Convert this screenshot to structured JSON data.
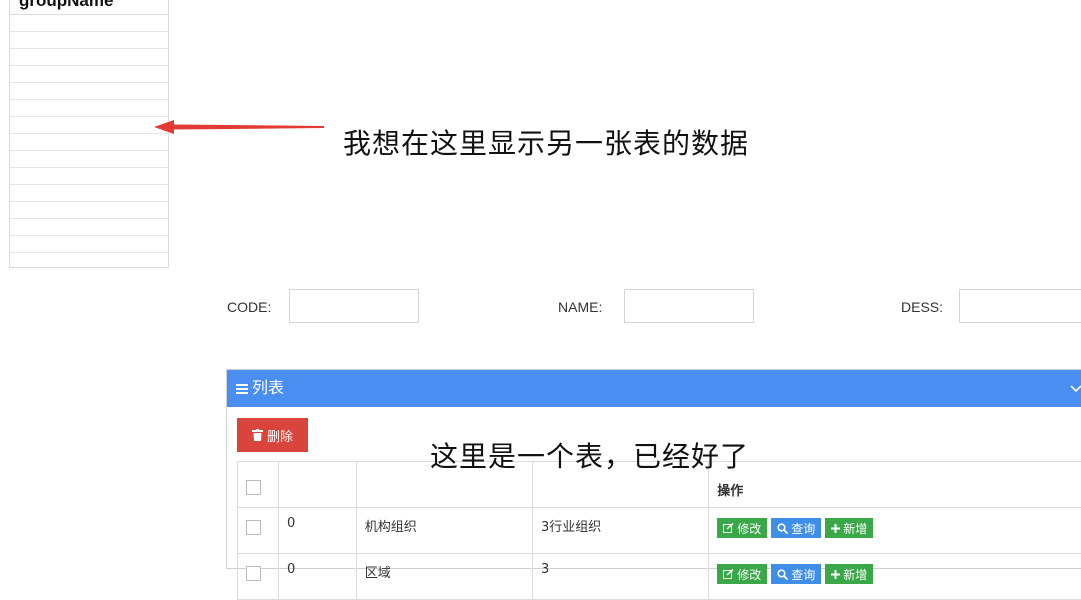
{
  "left_table": {
    "header": "groupName",
    "empty_row_count": 15
  },
  "annotations": {
    "note_left": "我想在这里显示另一张表的数据",
    "note_table": "这里是一个表，已经好了"
  },
  "search_form": {
    "code_label": "CODE:",
    "code_value": "",
    "name_label": "NAME:",
    "name_value": "",
    "dess_label": "DESS:",
    "dess_value": ""
  },
  "panel": {
    "title": "列表",
    "menu_icon": "menu-icon",
    "collapse_icon": "chevron-down-icon",
    "accent_color": "#4a8ef2",
    "delete_label": "删除"
  },
  "table": {
    "headers": [
      "",
      "",
      "",
      "操作"
    ],
    "rows": [
      {
        "c1": "0",
        "c2": "机构组织",
        "c3": "3行业组织"
      },
      {
        "c1": "0",
        "c2": "区域",
        "c3": "3"
      }
    ],
    "actions": {
      "edit": "修改",
      "view": "查询",
      "add": "新增"
    }
  }
}
